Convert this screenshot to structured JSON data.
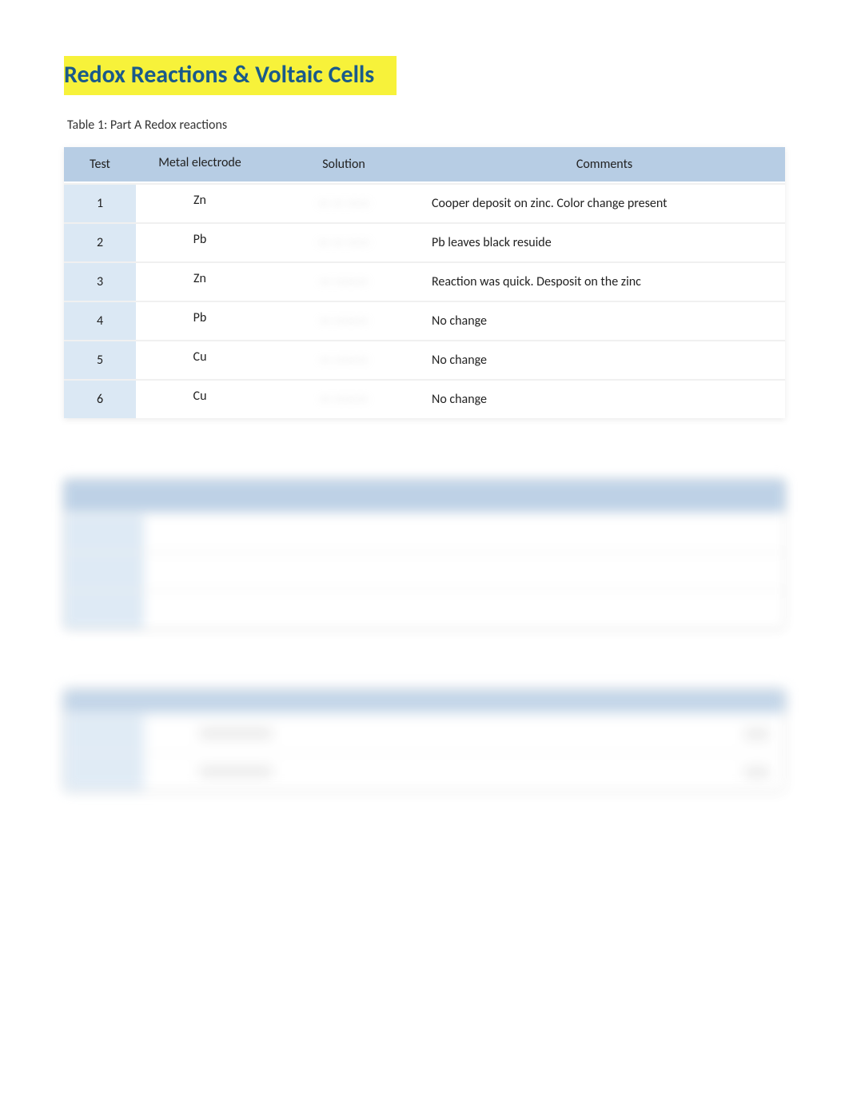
{
  "title": "Redox Reactions & Voltaic Cells",
  "table1": {
    "caption": "Table 1: Part A Redox reactions",
    "headers": {
      "test": "Test",
      "electrode": "Metal electrode",
      "solution": "Solution",
      "comments": "Comments"
    },
    "rows": [
      {
        "test": "1",
        "electrode": "Zn",
        "solution": "",
        "comments": "Cooper deposit on zinc. Color change present"
      },
      {
        "test": "2",
        "electrode": "Pb",
        "solution": "",
        "comments": "Pb leaves black resuide"
      },
      {
        "test": "3",
        "electrode": "Zn",
        "solution": "",
        "comments": "Reaction was quick. Desposit on the zinc"
      },
      {
        "test": "4",
        "electrode": "Pb",
        "solution": "",
        "comments": "No change"
      },
      {
        "test": "5",
        "electrode": "Cu",
        "solution": "",
        "comments": "No change"
      },
      {
        "test": "6",
        "electrode": "Cu",
        "solution": "",
        "comments": "No change"
      }
    ]
  }
}
